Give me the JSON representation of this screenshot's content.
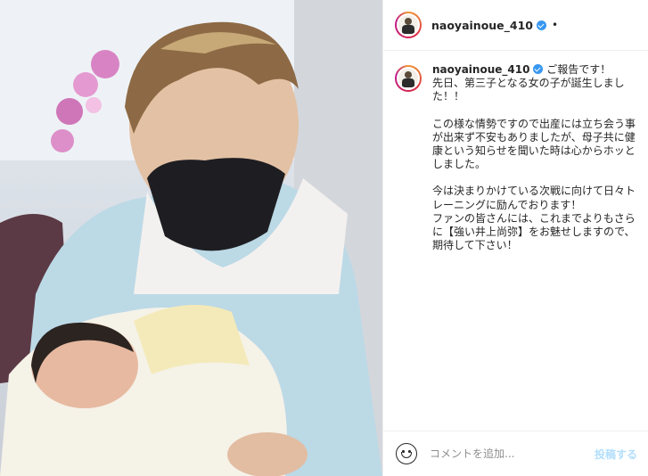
{
  "post": {
    "username": "naoyainoue_410",
    "header_separator": "•",
    "caption": {
      "username": "naoyainoue_410",
      "paragraphs": [
        "ご報告です！\n先日、第三子となる女の子が誕生しました！！",
        "この様な情勢ですので出産には立ち会う事が出来ず不安もありましたが、母子共に健康という知らせを聞いた時は心からホッとしました。",
        "今は決まりかけている次戦に向けて日々トレーニングに励んでおります！\nファンの皆さんには、これまでよりもさらに【強い井上尚弥】をお魅せしますので、期待して下さい！"
      ]
    },
    "composer": {
      "placeholder": "コメントを追加...",
      "post_label": "投稿する"
    },
    "icons": {
      "verified": "verified-badge-icon",
      "emoji": "emoji-smiley-icon"
    },
    "colors": {
      "verified": "#3897f0",
      "post_button_disabled": "#b2dffc",
      "border": "#efefef",
      "text": "#262626",
      "placeholder": "#8e8e8e"
    }
  }
}
